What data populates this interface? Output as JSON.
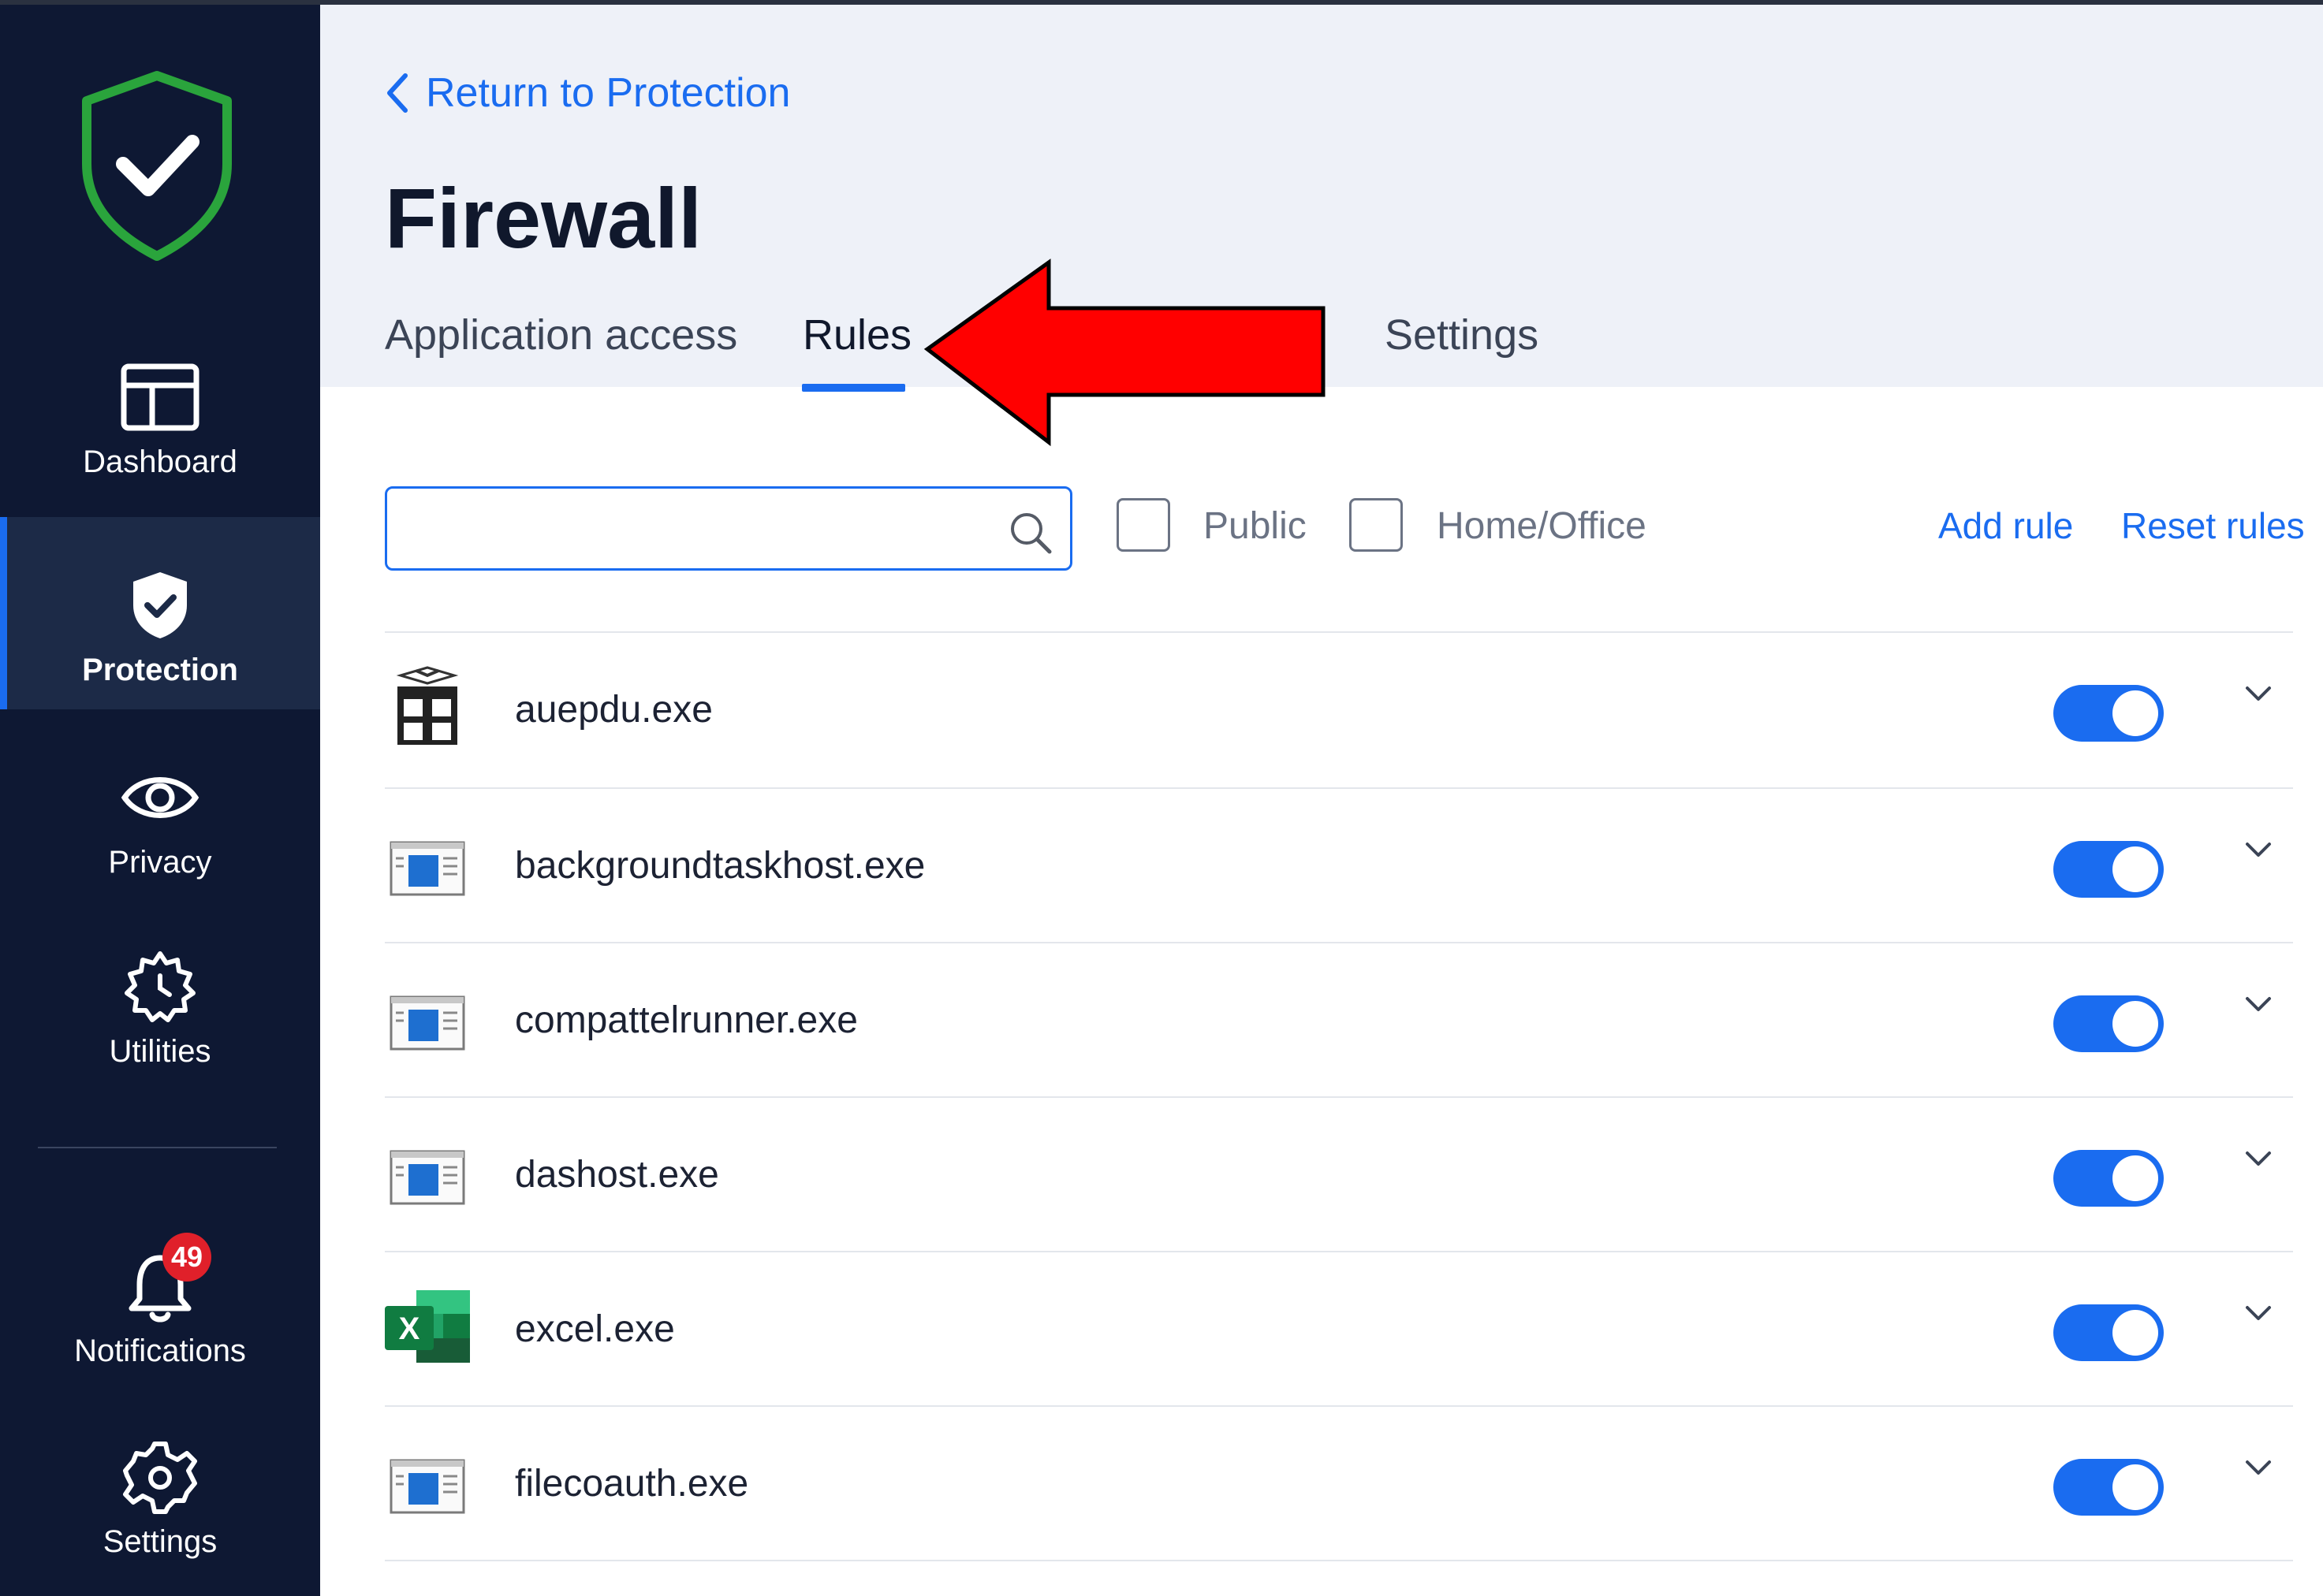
{
  "sidebar": {
    "items": [
      {
        "label": "Dashboard",
        "icon": "dashboard-icon"
      },
      {
        "label": "Protection",
        "icon": "shield-check-icon",
        "active": true
      },
      {
        "label": "Privacy",
        "icon": "eye-icon"
      },
      {
        "label": "Utilities",
        "icon": "utilities-gear-icon"
      },
      {
        "label": "Notifications",
        "icon": "bell-icon",
        "badge": "49"
      },
      {
        "label": "Settings",
        "icon": "gear-icon"
      }
    ]
  },
  "header": {
    "back_label": "Return to Protection",
    "title": "Firewall",
    "tabs": [
      {
        "label": "Application access"
      },
      {
        "label": "Rules",
        "active": true
      },
      {
        "label": "Settings"
      }
    ]
  },
  "toolbar": {
    "search_placeholder": "",
    "filters": [
      {
        "label": "Public",
        "checked": false
      },
      {
        "label": "Home/Office",
        "checked": false
      }
    ],
    "add_rule": "Add rule",
    "reset_rules": "Reset rules"
  },
  "rules": [
    {
      "name": "auepdu.exe",
      "icon": "package-icon",
      "enabled": true
    },
    {
      "name": "backgroundtaskhost.exe",
      "icon": "window-app-icon",
      "enabled": true
    },
    {
      "name": "compattelrunner.exe",
      "icon": "window-app-icon",
      "enabled": true
    },
    {
      "name": "dashost.exe",
      "icon": "window-app-icon",
      "enabled": true
    },
    {
      "name": "excel.exe",
      "icon": "excel-icon",
      "enabled": true
    },
    {
      "name": "filecoauth.exe",
      "icon": "window-app-icon",
      "enabled": true
    }
  ],
  "colors": {
    "sidebar_bg": "#0e1833",
    "accent": "#1a6cf0",
    "header_bg": "#eef1f8",
    "annotation_arrow": "#ff0000"
  }
}
